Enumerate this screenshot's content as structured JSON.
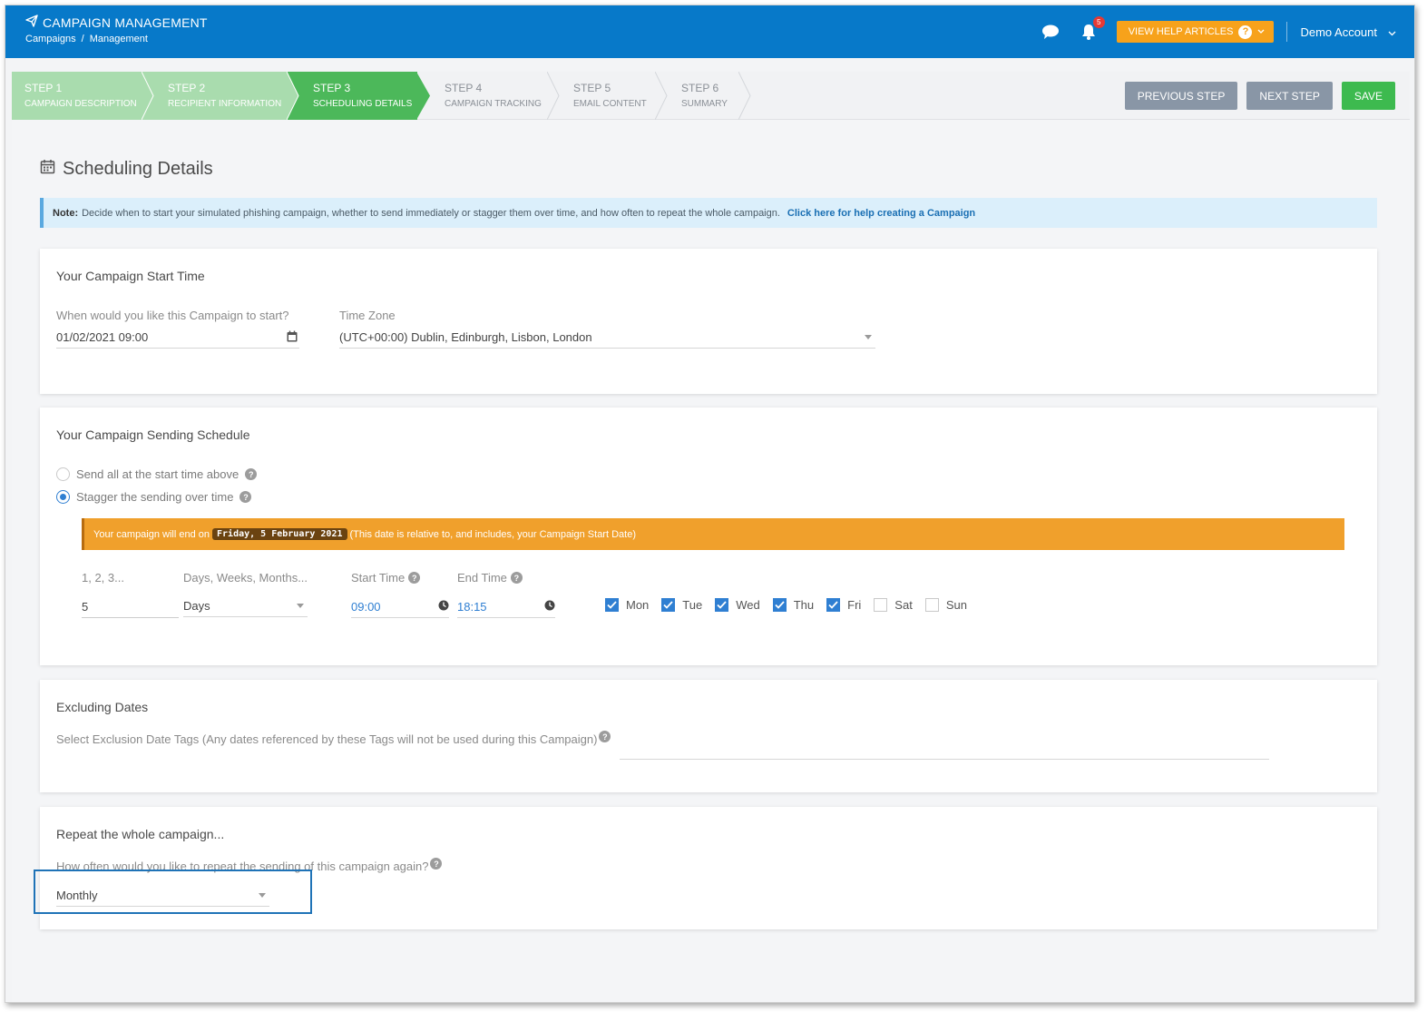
{
  "header": {
    "title": "CAMPAIGN MANAGEMENT",
    "breadcrumb": [
      "Campaigns",
      "Management"
    ],
    "notification_count": "5",
    "help_label": "VIEW HELP ARTICLES",
    "account_label": "Demo Account",
    "colors": {
      "bar": "#0779c9",
      "help": "#f7a21b",
      "badge": "#e53935"
    }
  },
  "steps": [
    {
      "num": "STEP 1",
      "label": "CAMPAIGN DESCRIPTION",
      "state": "done"
    },
    {
      "num": "STEP 2",
      "label": "RECIPIENT INFORMATION",
      "state": "done"
    },
    {
      "num": "STEP 3",
      "label": "SCHEDULING DETAILS",
      "state": "active"
    },
    {
      "num": "STEP 4",
      "label": "CAMPAIGN TRACKING",
      "state": "todo"
    },
    {
      "num": "STEP 5",
      "label": "EMAIL CONTENT",
      "state": "todo"
    },
    {
      "num": "STEP 6",
      "label": "SUMMARY",
      "state": "todo"
    }
  ],
  "actions": {
    "previous": "PREVIOUS STEP",
    "next": "NEXT STEP",
    "save": "SAVE"
  },
  "page": {
    "title": "Scheduling Details",
    "note_bold": "Note:",
    "note_text": "Decide when to start your simulated phishing campaign, whether to send immediately or stagger them over time, and how often to repeat the whole campaign.",
    "note_link": "Click here for help creating a Campaign"
  },
  "start_time": {
    "title": "Your Campaign Start Time",
    "date_label": "When would you like this Campaign to start?",
    "date_value": "01/02/2021 09:00",
    "tz_label": "Time Zone",
    "tz_value": "(UTC+00:00) Dublin, Edinburgh, Lisbon, London"
  },
  "sending": {
    "title": "Your Campaign Sending Schedule",
    "option_all": "Send all at the start time above",
    "option_stagger": "Stagger the sending over time",
    "selected": "stagger",
    "warn_prefix": "Your campaign will end on",
    "warn_date": "Friday, 5 February 2021",
    "warn_suffix": "(This date is relative to, and includes, your Campaign Start Date)",
    "count_label": "1, 2, 3...",
    "count_value": "5",
    "unit_label": "Days, Weeks, Months...",
    "unit_value": "Days",
    "start_label": "Start Time",
    "start_value": "09:00",
    "end_label": "End Time",
    "end_value": "18:15",
    "days": [
      {
        "label": "Mon",
        "checked": true
      },
      {
        "label": "Tue",
        "checked": true
      },
      {
        "label": "Wed",
        "checked": true
      },
      {
        "label": "Thu",
        "checked": true
      },
      {
        "label": "Fri",
        "checked": true
      },
      {
        "label": "Sat",
        "checked": false
      },
      {
        "label": "Sun",
        "checked": false
      }
    ]
  },
  "excluding": {
    "title": "Excluding Dates",
    "label": "Select Exclusion Date Tags (Any dates referenced by these Tags will not be used during this Campaign)"
  },
  "repeat": {
    "title": "Repeat the whole campaign...",
    "label": "How often would you like to repeat the sending of this campaign again?",
    "value": "Monthly"
  }
}
